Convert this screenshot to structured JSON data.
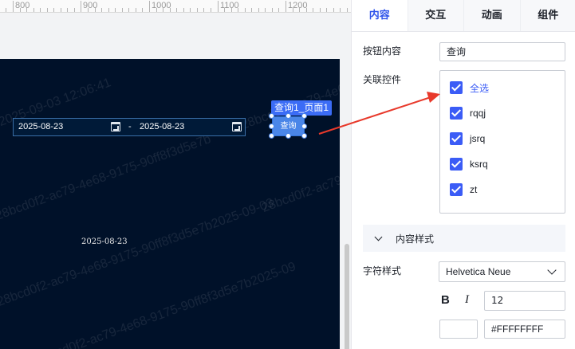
{
  "ruler": {
    "labels": [
      "800",
      "900",
      "1000",
      "1100",
      "1200"
    ]
  },
  "canvas": {
    "watermarks": [
      "2025-09-03 12:06:41",
      "28bcd0f2-ac79-4e68-9175-90ff8f3d5e7b",
      "7b2025-09-03 12:06:41",
      "28bcd0f2-ac79-4e68-9175-90ff8f3d5e7b2025-09-03",
      "bcd0f2-ac79-4e68-9175-90ff8f3d5e7b2025-09",
      "5e7b2025-09-03 12:06:41"
    ],
    "date_start": "2025-08-23",
    "date_sep": "-",
    "date_end": "2025-08-23",
    "static_date": "2025-08-23",
    "selection_label": "查询1_页面1",
    "query_button": "查询"
  },
  "panel": {
    "tabs": [
      {
        "label": "内容",
        "active": true
      },
      {
        "label": "交互",
        "active": false
      },
      {
        "label": "动画",
        "active": false
      },
      {
        "label": "组件",
        "active": false
      }
    ],
    "button_content_label": "按钮内容",
    "button_content_value": "查询",
    "linked_controls_label": "关联控件",
    "linked_controls": [
      {
        "label": "全选",
        "checked": true
      },
      {
        "label": "rqqj",
        "checked": true
      },
      {
        "label": "jsrq",
        "checked": true
      },
      {
        "label": "ksrq",
        "checked": true
      },
      {
        "label": "zt",
        "checked": true
      }
    ],
    "section_title": "内容样式",
    "font_style_label": "字符样式",
    "font_family": "Helvetica Neue",
    "bold_label": "B",
    "italic_label": "I",
    "font_size": "12",
    "font_color": "#FFFFFFFF"
  },
  "colors": {
    "stage_bg": "#001129",
    "accent": "#3b5cf6",
    "arrow": "#e8392b"
  }
}
